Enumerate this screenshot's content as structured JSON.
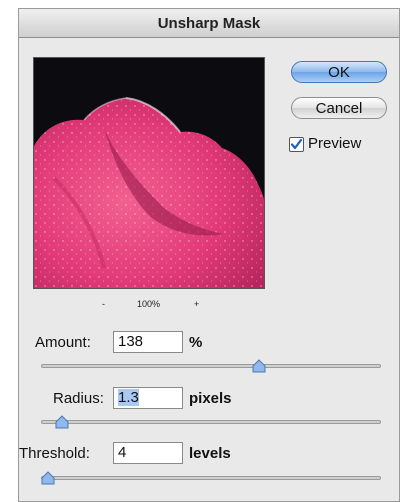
{
  "dialog": {
    "title": "Unsharp Mask"
  },
  "preview_zoom": {
    "zoom_out_label": "-",
    "zoom_level": "100%",
    "zoom_in_label": "+"
  },
  "buttons": {
    "ok_label": "OK",
    "cancel_label": "Cancel"
  },
  "preview_option": {
    "label": "Preview",
    "checked": true
  },
  "fields": {
    "amount": {
      "label": "Amount:",
      "value": "138",
      "unit": "%",
      "slider_fraction": 0.63
    },
    "radius": {
      "label": "Radius:",
      "value": "1.3",
      "unit": "pixels",
      "slider_fraction": 0.06
    },
    "threshold": {
      "label": "Threshold:",
      "value": "4",
      "unit": "levels",
      "slider_fraction": 0.02
    }
  },
  "colors": {
    "ok_button": "#7fb1ea",
    "petal": "#e23a78",
    "preview_background": "#0c0c10"
  }
}
